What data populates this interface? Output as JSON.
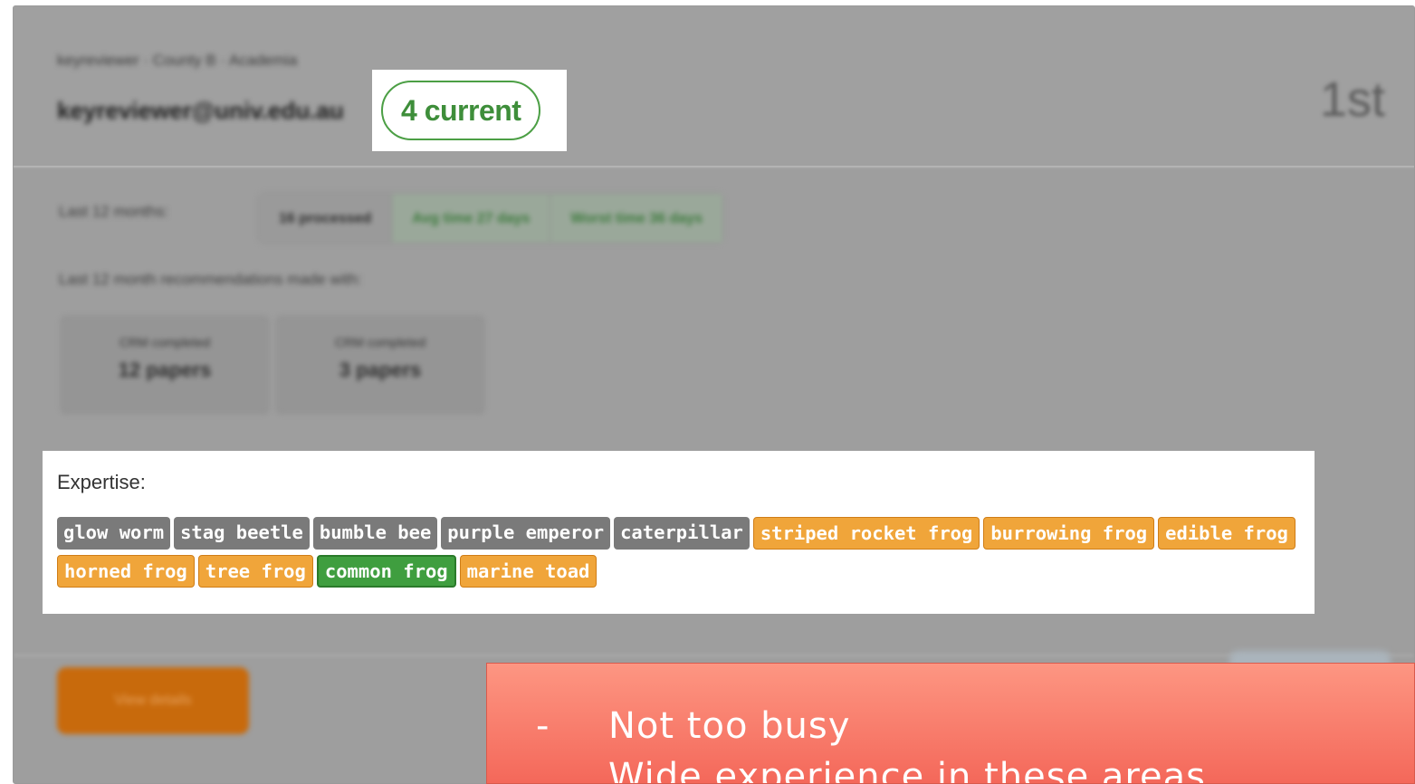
{
  "reviewer": {
    "subline": "keyreviewer · County B · Academia",
    "email": "keyreviewer@univ.edu.au",
    "current_badge": "4 current",
    "rank": "1st"
  },
  "stats": {
    "last_12_label": "Last 12 months:",
    "processed": "16 processed",
    "avg_time": "Avg time 27 days",
    "worst_time": "Worst time 36 days",
    "recommendations_label": "Last 12 month recommendations made with:"
  },
  "recommendation_boxes": [
    {
      "label": "CRM completed",
      "value": "12 papers"
    },
    {
      "label": "CRM completed",
      "value": "3 papers"
    }
  ],
  "expertise": {
    "label": "Expertise:",
    "tags": [
      {
        "text": "glow worm",
        "color": "grey"
      },
      {
        "text": "stag beetle",
        "color": "grey"
      },
      {
        "text": "bumble bee",
        "color": "grey"
      },
      {
        "text": "purple emperor",
        "color": "grey"
      },
      {
        "text": "caterpillar",
        "color": "grey"
      },
      {
        "text": "striped rocket frog",
        "color": "orange"
      },
      {
        "text": "burrowing frog",
        "color": "orange"
      },
      {
        "text": "edible frog",
        "color": "orange"
      },
      {
        "text": "horned frog",
        "color": "orange"
      },
      {
        "text": "tree frog",
        "color": "orange"
      },
      {
        "text": "common frog",
        "color": "green"
      },
      {
        "text": "marine toad",
        "color": "orange"
      }
    ]
  },
  "actions": {
    "view_details": "View details"
  },
  "callout": {
    "bullet": "-",
    "lines": [
      "Not too busy",
      "Wide experience in these areas"
    ]
  },
  "colors": {
    "tag_grey": "#7a7a7a",
    "tag_orange": "#f0a53a",
    "tag_green": "#3f9e3f",
    "badge_green": "#3e8e3a",
    "callout_bg": "#f77a6a"
  }
}
